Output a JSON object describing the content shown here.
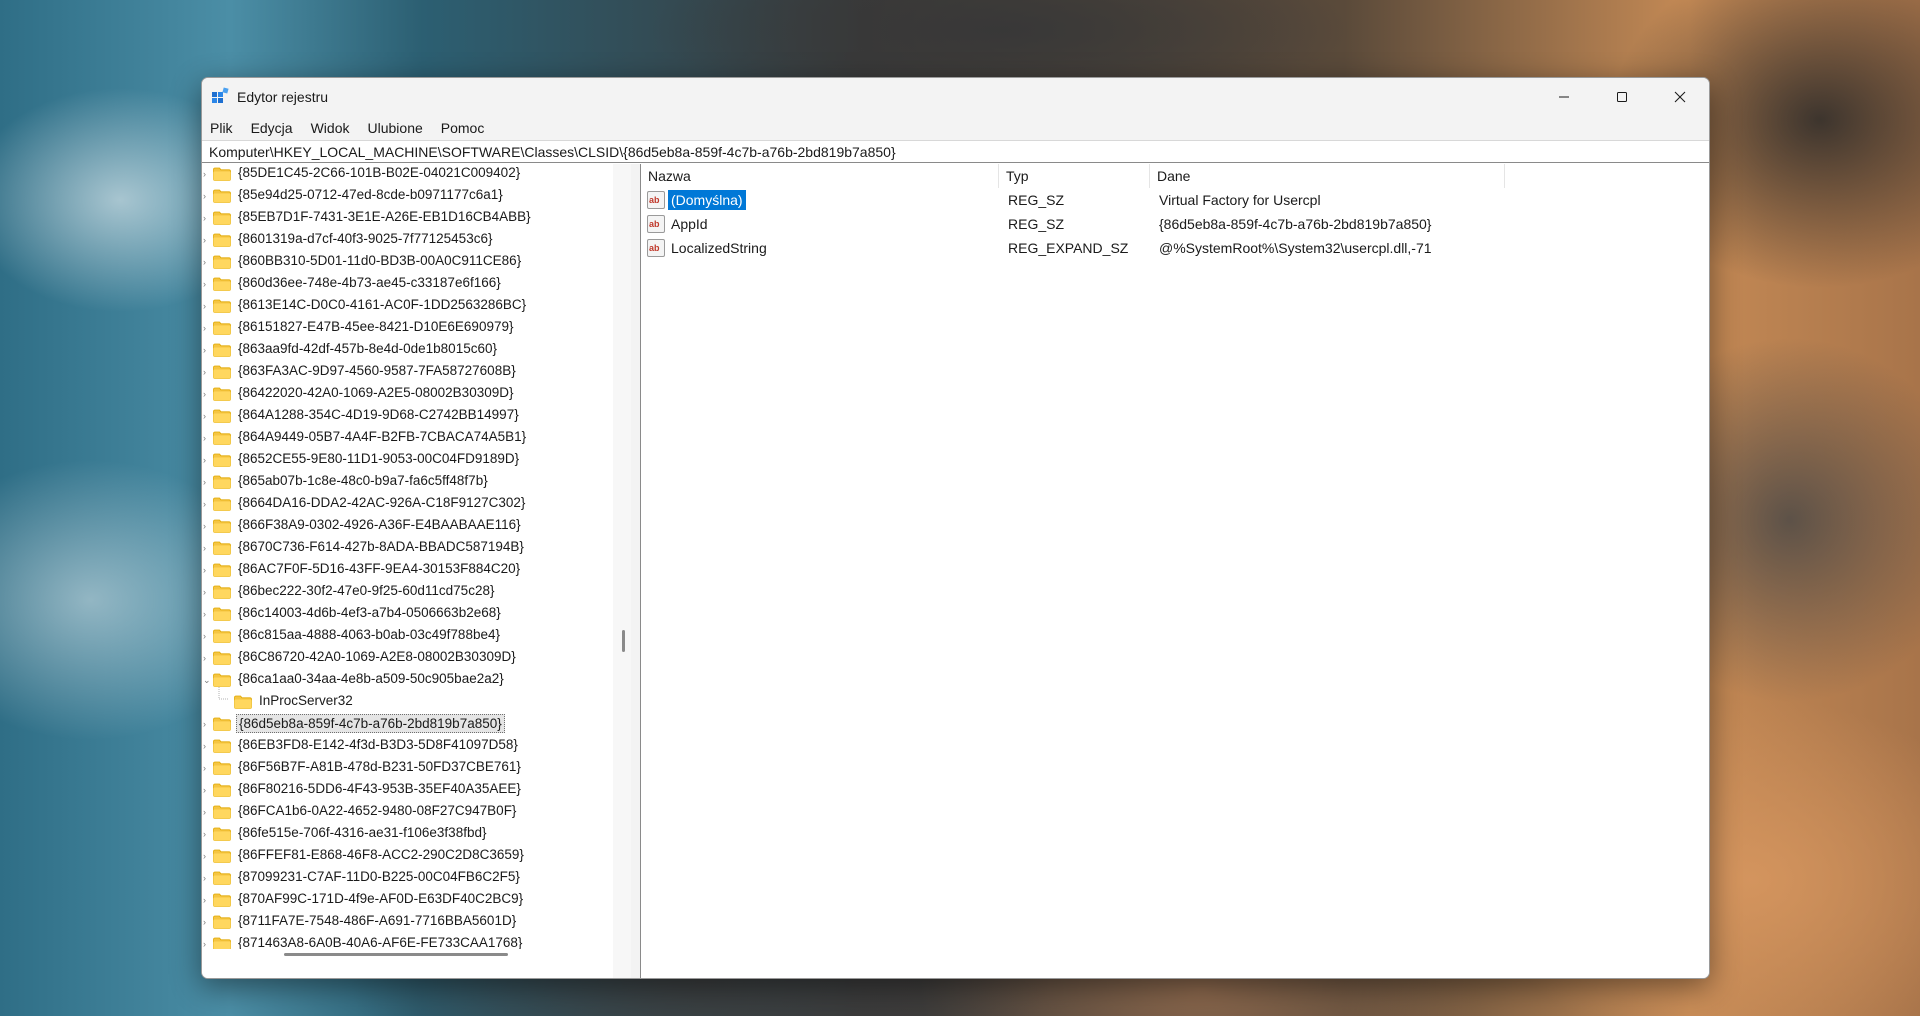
{
  "window": {
    "title": "Edytor rejestru",
    "controls": {
      "minimize": "minimize-icon",
      "maximize": "maximize-icon",
      "close": "close-icon"
    }
  },
  "menu": [
    "Plik",
    "Edycja",
    "Widok",
    "Ulubione",
    "Pomoc"
  ],
  "address": "Komputer\\HKEY_LOCAL_MACHINE\\SOFTWARE\\Classes\\CLSID\\{86d5eb8a-859f-4c7b-a76b-2bd819b7a850}",
  "tree": [
    {
      "label": "{85DE1C45-2C66-101B-B02E-04021C009402}",
      "level": 0
    },
    {
      "label": "{85e94d25-0712-47ed-8cde-b0971177c6a1}",
      "level": 0
    },
    {
      "label": "{85EB7D1F-7431-3E1E-A26E-EB1D16CB4ABB}",
      "level": 0
    },
    {
      "label": "{8601319a-d7cf-40f3-9025-7f77125453c6}",
      "level": 0
    },
    {
      "label": "{860BB310-5D01-11d0-BD3B-00A0C911CE86}",
      "level": 0
    },
    {
      "label": "{860d36ee-748e-4b73-ae45-c33187e6f166}",
      "level": 0
    },
    {
      "label": "{8613E14C-D0C0-4161-AC0F-1DD2563286BC}",
      "level": 0
    },
    {
      "label": "{86151827-E47B-45ee-8421-D10E6E690979}",
      "level": 0
    },
    {
      "label": "{863aa9fd-42df-457b-8e4d-0de1b8015c60}",
      "level": 0
    },
    {
      "label": "{863FA3AC-9D97-4560-9587-7FA58727608B}",
      "level": 0
    },
    {
      "label": "{86422020-42A0-1069-A2E5-08002B30309D}",
      "level": 0
    },
    {
      "label": "{864A1288-354C-4D19-9D68-C2742BB14997}",
      "level": 0
    },
    {
      "label": "{864A9449-05B7-4A4F-B2FB-7CBACA74A5B1}",
      "level": 0
    },
    {
      "label": "{8652CE55-9E80-11D1-9053-00C04FD9189D}",
      "level": 0
    },
    {
      "label": "{865ab07b-1c8e-48c0-b9a7-fa6c5ff48f7b}",
      "level": 0
    },
    {
      "label": "{8664DA16-DDA2-42AC-926A-C18F9127C302}",
      "level": 0
    },
    {
      "label": "{866F38A9-0302-4926-A36F-E4BAABAAE116}",
      "level": 0
    },
    {
      "label": "{8670C736-F614-427b-8ADA-BBADC587194B}",
      "level": 0
    },
    {
      "label": "{86AC7F0F-5D16-43FF-9EA4-30153F884C20}",
      "level": 0
    },
    {
      "label": "{86bec222-30f2-47e0-9f25-60d11cd75c28}",
      "level": 0
    },
    {
      "label": "{86c14003-4d6b-4ef3-a7b4-0506663b2e68}",
      "level": 0
    },
    {
      "label": "{86c815aa-4888-4063-b0ab-03c49f788be4}",
      "level": 0
    },
    {
      "label": "{86C86720-42A0-1069-A2E8-08002B30309D}",
      "level": 0
    },
    {
      "label": "{86ca1aa0-34aa-4e8b-a509-50c905bae2a2}",
      "level": 0,
      "expanded": true
    },
    {
      "label": "InProcServer32",
      "level": 1
    },
    {
      "label": "{86d5eb8a-859f-4c7b-a76b-2bd819b7a850}",
      "level": 0,
      "selected": true
    },
    {
      "label": "{86EB3FD8-E142-4f3d-B3D3-5D8F41097D58}",
      "level": 0
    },
    {
      "label": "{86F56B7F-A81B-478d-B231-50FD37CBE761}",
      "level": 0
    },
    {
      "label": "{86F80216-5DD6-4F43-953B-35EF40A35AEE}",
      "level": 0
    },
    {
      "label": "{86FCA1b6-0A22-4652-9480-08F27C947B0F}",
      "level": 0
    },
    {
      "label": "{86fe515e-706f-4316-ae31-f106e3f38fbd}",
      "level": 0
    },
    {
      "label": "{86FFEF81-E868-46F8-ACC2-290C2D8C3659}",
      "level": 0
    },
    {
      "label": "{87099231-C7AF-11D0-B225-00C04FB6C2F5}",
      "level": 0
    },
    {
      "label": "{870AF99C-171D-4f9e-AF0D-E63DF40C2BC9}",
      "level": 0
    },
    {
      "label": "{8711FA7E-7548-486F-A691-7716BBA5601D}",
      "level": 0
    },
    {
      "label": "{871463A8-6A0B-40A6-AF6E-FE733CAA1768}",
      "level": 0
    }
  ],
  "list": {
    "columns": [
      "Nazwa",
      "Typ",
      "Dane"
    ],
    "rows": [
      {
        "name": "(Domyślna)",
        "type": "REG_SZ",
        "data": "Virtual Factory for Usercpl",
        "selected": true
      },
      {
        "name": "AppId",
        "type": "REG_SZ",
        "data": "{86d5eb8a-859f-4c7b-a76b-2bd819b7a850}"
      },
      {
        "name": "LocalizedString",
        "type": "REG_EXPAND_SZ",
        "data": "@%SystemRoot%\\System32\\usercpl.dll,-71"
      }
    ]
  },
  "colors": {
    "selection": "#0078d7",
    "folder": "#f5c542",
    "folder_dark": "#e0a800"
  }
}
